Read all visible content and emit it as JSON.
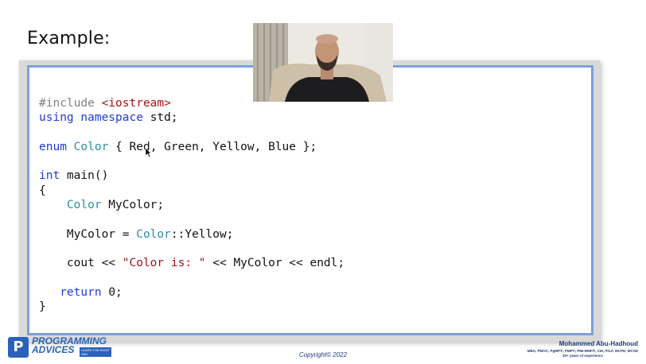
{
  "slide": {
    "title": "Example:"
  },
  "code_lines": [
    "#include <iostream>",
    "using namespace std;",
    "",
    "enum Color { Red, Green, Yellow, Blue };",
    "",
    "int main()",
    "{",
    "    Color MyColor;",
    "",
    "    MyColor = Color::Yellow;",
    "",
    "    cout << \"Color is: \" << MyColor << endl;",
    "",
    "   return 0;",
    "}"
  ],
  "footer": {
    "logo_letter": "P",
    "logo_line1": "PROGRAMMING",
    "logo_line2": "ADVICES",
    "logo_tag": "LEARN THE RIGHT WAY",
    "copyright": "Copyright© 2022",
    "author_name": "Mohammed Abu-Hadhoud",
    "author_credentials": "MBA, PMOC, PgMP®, PMP®, PMI-RMP®, CM, ITILF, MCPD, MCSD",
    "author_experience": "20+ years of experience"
  },
  "colors": {
    "keyword": "#1f3bd6",
    "type": "#2b8fa8",
    "string": "#a31515",
    "preprocessor": "#808080",
    "panel_border": "#7aa0d8",
    "brand": "#2a62b8"
  },
  "icons": {
    "cursor": "mouse-cursor-icon",
    "webcam": "presenter-webcam"
  }
}
